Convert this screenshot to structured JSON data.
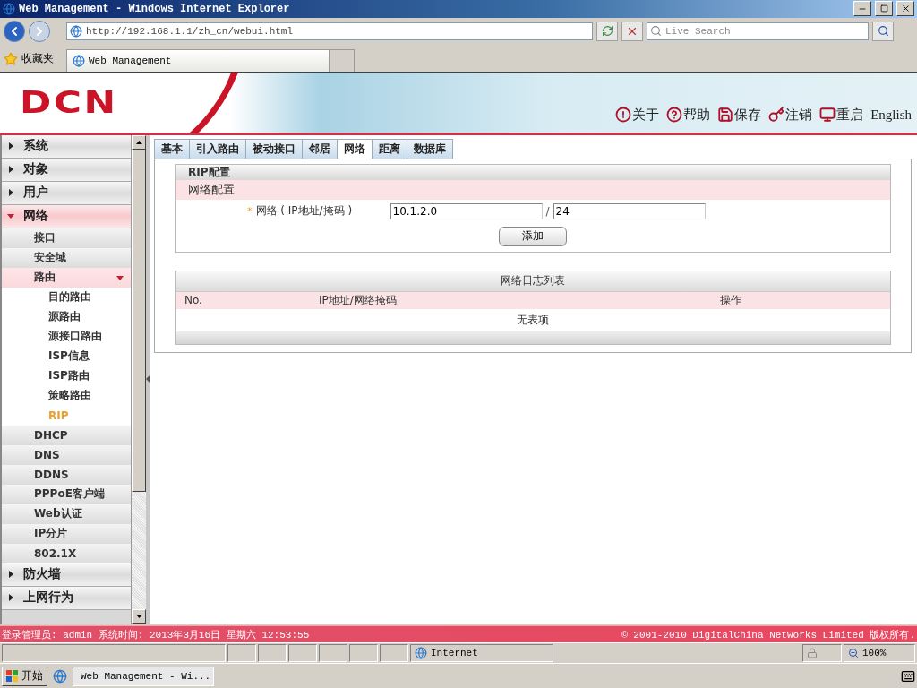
{
  "window": {
    "title": "Web Management - Windows Internet Explorer"
  },
  "browser": {
    "address": "http://192.168.1.1/zh_cn/webui.html",
    "search_placeholder": "Live Search",
    "favorites": "收藏夹",
    "tab": "Web Management"
  },
  "header": {
    "logo": "DCN",
    "links": [
      {
        "kind": "about",
        "label": "关于"
      },
      {
        "kind": "help",
        "label": "帮助"
      },
      {
        "kind": "save",
        "label": "保存"
      },
      {
        "kind": "logout",
        "label": "注销"
      },
      {
        "kind": "restart",
        "label": "重启"
      },
      {
        "kind": "text",
        "label": "English"
      }
    ]
  },
  "sidebar": {
    "items": [
      {
        "label": "系统",
        "expanded": false,
        "selected": false
      },
      {
        "label": "对象",
        "expanded": false,
        "selected": false
      },
      {
        "label": "用户",
        "expanded": false,
        "selected": false
      },
      {
        "label": "网络",
        "expanded": true,
        "selected": true,
        "children": [
          {
            "label": "接口",
            "selected": false
          },
          {
            "label": "安全域",
            "selected": false
          },
          {
            "label": "路由",
            "expanded": true,
            "selected": true,
            "children": [
              {
                "label": "目的路由",
                "selected": false
              },
              {
                "label": "源路由",
                "selected": false
              },
              {
                "label": "源接口路由",
                "selected": false
              },
              {
                "label": "ISP信息",
                "selected": false
              },
              {
                "label": "ISP路由",
                "selected": false
              },
              {
                "label": "策略路由",
                "selected": false
              },
              {
                "label": "RIP",
                "selected": true
              }
            ]
          },
          {
            "label": "DHCP",
            "selected": false
          },
          {
            "label": "DNS",
            "selected": false
          },
          {
            "label": "DDNS",
            "selected": false
          },
          {
            "label": "PPPoE客户端",
            "selected": false
          },
          {
            "label": "Web认证",
            "selected": false
          },
          {
            "label": "IP分片",
            "selected": false
          },
          {
            "label": "802.1X",
            "selected": false
          }
        ]
      },
      {
        "label": "防火墙",
        "expanded": false,
        "selected": false
      },
      {
        "label": "上网行为",
        "expanded": false,
        "selected": false
      }
    ]
  },
  "tabs": [
    {
      "label": "基本",
      "selected": false
    },
    {
      "label": "引入路由",
      "selected": false
    },
    {
      "label": "被动接口",
      "selected": false
    },
    {
      "label": "邻居",
      "selected": false
    },
    {
      "label": "网络",
      "selected": true
    },
    {
      "label": "距离",
      "selected": false
    },
    {
      "label": "数据库",
      "selected": false
    }
  ],
  "rip_section": {
    "title": "RIP配置",
    "subtitle": "网络配置",
    "required_mark": "*",
    "field_label": "网络 ( IP地址/掩码 )",
    "ip": "10.1.2.0",
    "separator": "/",
    "mask": "24",
    "button": "添加"
  },
  "table": {
    "title": "网络日志列表",
    "columns": [
      "No.",
      "IP地址/网络掩码",
      "操作"
    ],
    "empty": "无表项"
  },
  "footer": {
    "left": "登录管理员: admin 系统时间: 2013年3月16日 星期六 12:53:55",
    "right": "© 2001-2010 DigitalChina Networks Limited 版权所有."
  },
  "status_bar": {
    "zone": "Internet",
    "zoom": "100%"
  },
  "taskbar": {
    "start": "开始",
    "window": "Web Management - Wi..."
  }
}
